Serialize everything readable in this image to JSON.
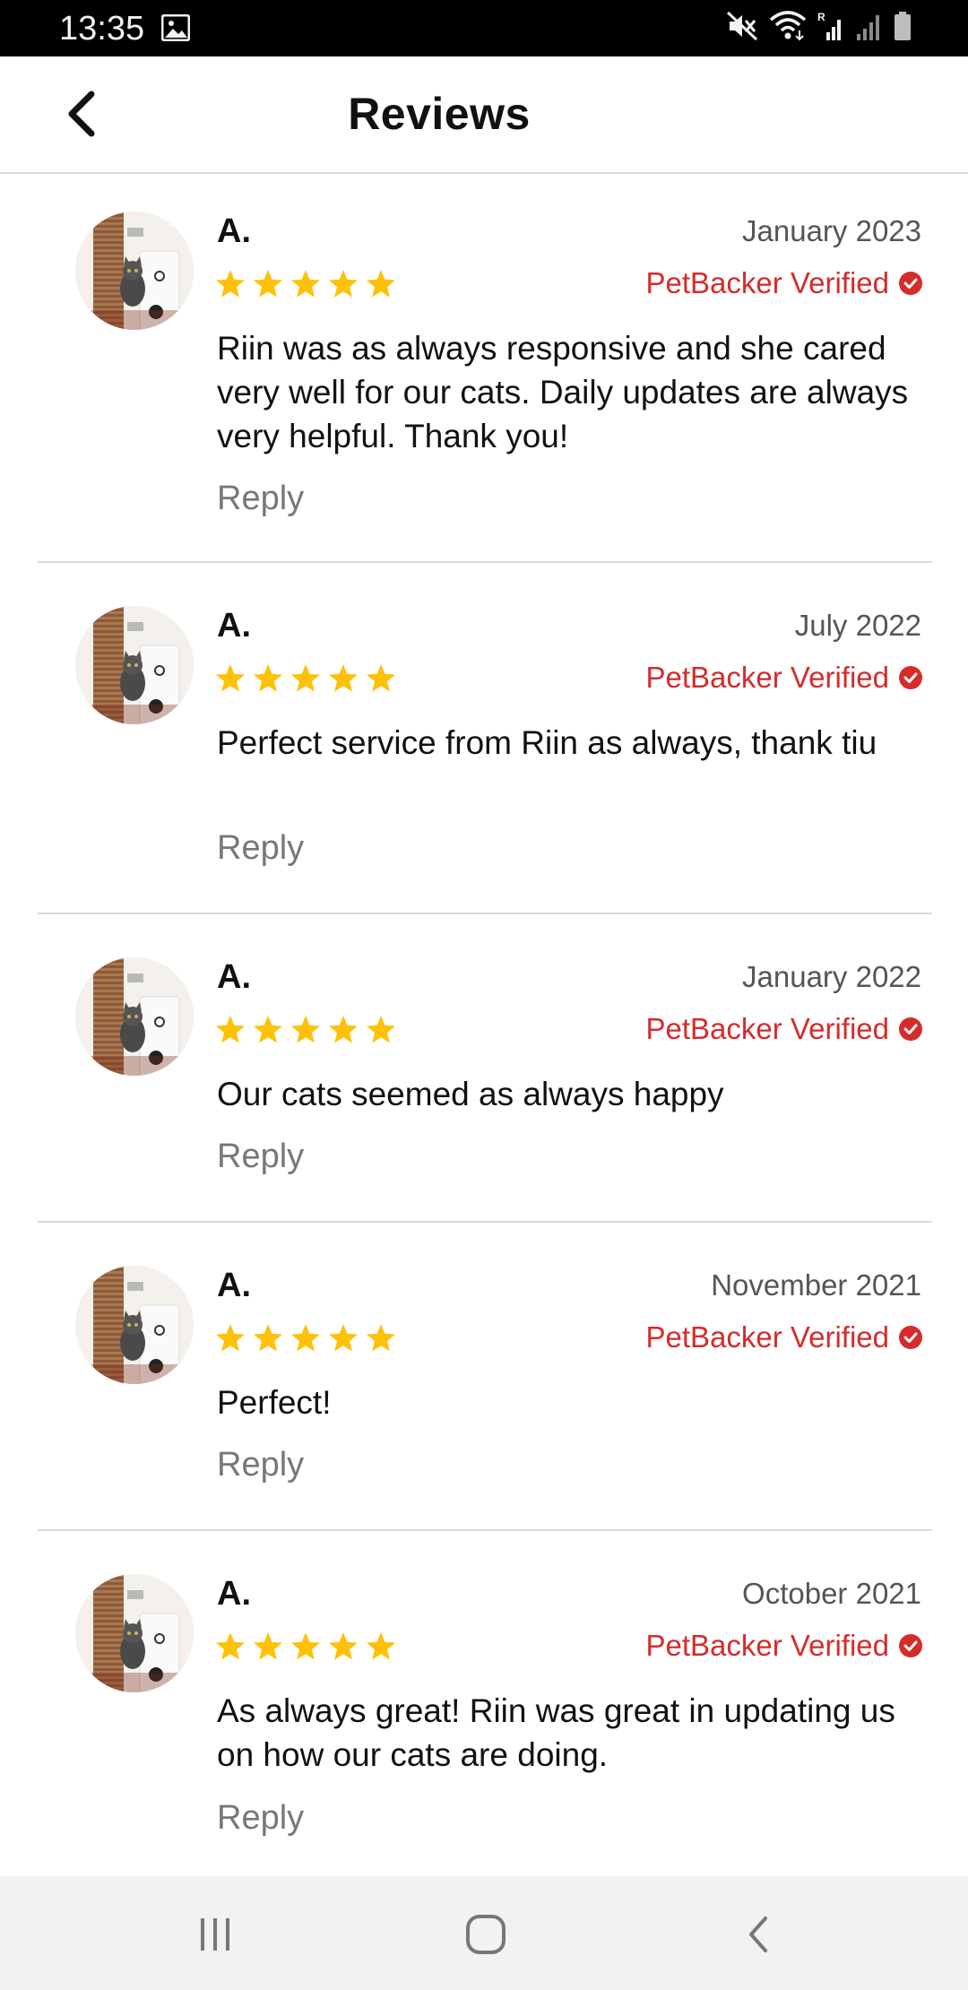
{
  "status_bar": {
    "time": "13:35",
    "icons": [
      "gallery-icon",
      "mute-icon",
      "wifi-icon",
      "signal-roaming-icon",
      "signal-icon",
      "battery-icon"
    ]
  },
  "header": {
    "title": "Reviews",
    "back_icon": "chevron-left-icon"
  },
  "colors": {
    "star": "#FFC107",
    "verified": "#D62B2B",
    "divider": "#D9D9D9",
    "reply": "#777777"
  },
  "reviews": [
    {
      "name": "A.",
      "date": "January 2023",
      "rating": 5,
      "verified_label": "PetBacker Verified",
      "text": "Riin was as always responsive and she cared very well for our cats. Daily updates are always very helpful. Thank you!",
      "reply_label": "Reply"
    },
    {
      "name": "A.",
      "date": "July 2022",
      "rating": 5,
      "verified_label": "PetBacker Verified",
      "text": "Perfect service from Riin as always, thank tiu",
      "reply_label": "Reply"
    },
    {
      "name": "A.",
      "date": "January 2022",
      "rating": 5,
      "verified_label": "PetBacker Verified",
      "text": "Our cats seemed as always happy",
      "reply_label": "Reply"
    },
    {
      "name": "A.",
      "date": "November 2021",
      "rating": 5,
      "verified_label": "PetBacker Verified",
      "text": "Perfect!",
      "reply_label": "Reply"
    },
    {
      "name": "A.",
      "date": "October 2021",
      "rating": 5,
      "verified_label": "PetBacker Verified",
      "text": "As always great! Riin was great in updating us on how our cats are doing.",
      "reply_label": "Reply"
    }
  ],
  "nav_bar": {
    "buttons": [
      "recent-apps-icon",
      "home-icon",
      "back-icon"
    ]
  }
}
